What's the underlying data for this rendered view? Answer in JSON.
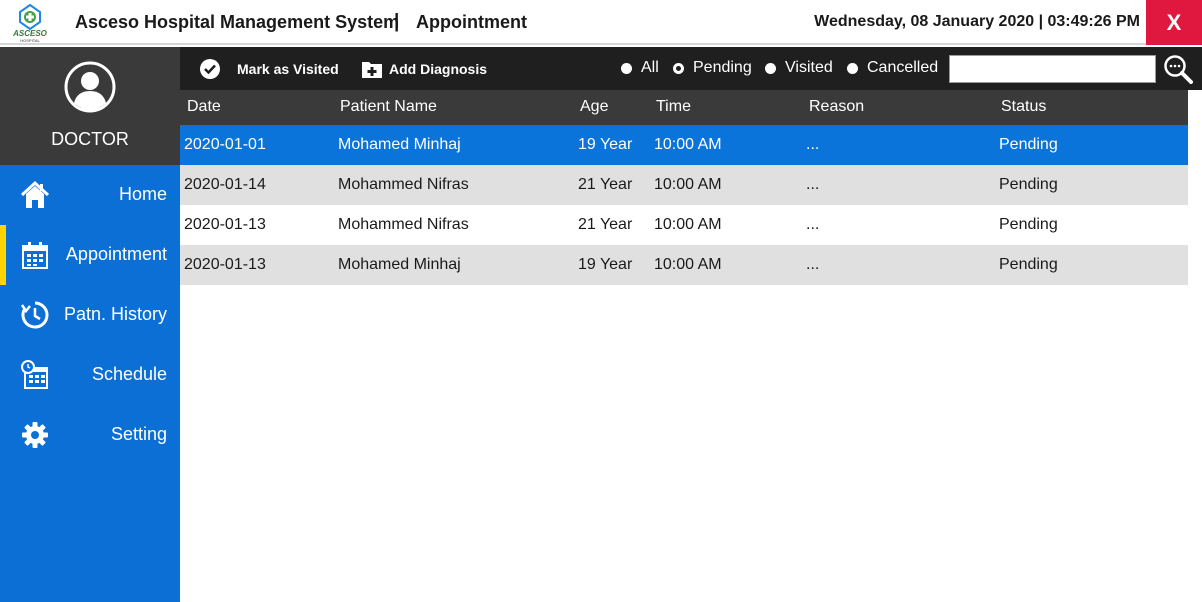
{
  "header": {
    "logo_text": "ASCESO",
    "logo_sub": "HOSPITAL",
    "app_title": "Asceso Hospital Management System",
    "separator": "|",
    "page_title": "Appointment",
    "datetime": "Wednesday, 08 January 2020 | 03:49:26 PM",
    "close_label": "X"
  },
  "profile": {
    "role": "DOCTOR"
  },
  "sidebar": {
    "items": [
      {
        "label": "Home",
        "icon": "home-icon"
      },
      {
        "label": "Appointment",
        "icon": "calendar-icon",
        "active": true
      },
      {
        "label": "Patn. History",
        "icon": "history-icon"
      },
      {
        "label": "Schedule",
        "icon": "schedule-icon"
      },
      {
        "label": "Setting",
        "icon": "gear-icon"
      }
    ]
  },
  "toolbar": {
    "mark_visited": "Mark as Visited",
    "add_diagnosis": "Add Diagnosis",
    "filters": [
      {
        "label": "All",
        "selected": false
      },
      {
        "label": "Pending",
        "selected": true
      },
      {
        "label": "Visited",
        "selected": false
      },
      {
        "label": "Cancelled",
        "selected": false
      }
    ],
    "search_value": ""
  },
  "table": {
    "columns": [
      "Date",
      "Patient Name",
      "Age",
      "Time",
      "Reason",
      "Status"
    ],
    "rows": [
      [
        "2020-01-01",
        "Mohamed Minhaj",
        "19 Year",
        "10:00 AM",
        "...",
        "Pending"
      ],
      [
        "2020-01-14",
        "Mohammed Nifras",
        "21 Year",
        "10:00 AM",
        "...",
        "Pending"
      ],
      [
        "2020-01-13",
        "Mohammed Nifras",
        "21 Year",
        "10:00 AM",
        "...",
        "Pending"
      ],
      [
        "2020-01-13",
        "Mohamed Minhaj",
        "19 Year",
        "10:00 AM",
        "...",
        "Pending"
      ]
    ]
  },
  "colors": {
    "sidebar": "#0b6fd6",
    "selected_row": "#0a74da",
    "close": "#e0173f",
    "active_bar": "#ffd400",
    "toolbar": "#1f1f1f"
  }
}
